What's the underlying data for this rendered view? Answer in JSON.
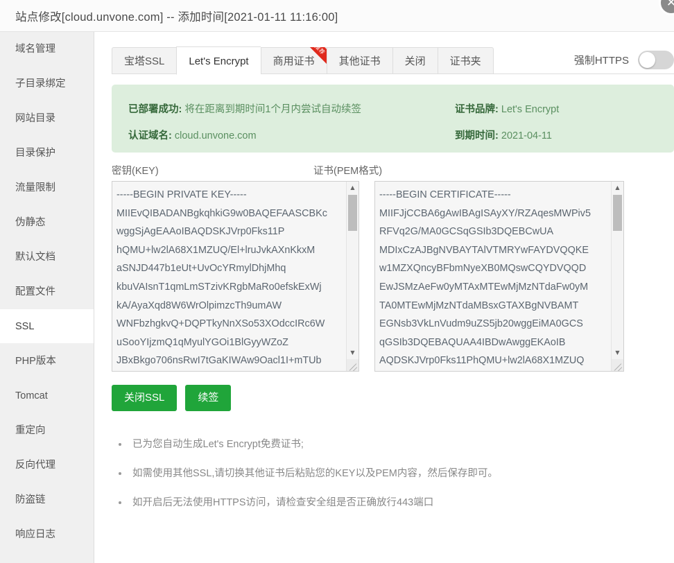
{
  "window": {
    "title": "站点修改[cloud.unvone.com] -- 添加时间[2021-01-11 11:16:00]",
    "close_icon": "close-icon",
    "close_glyph": "✕"
  },
  "sidebar": {
    "items": [
      {
        "label": "域名管理",
        "active": false
      },
      {
        "label": "子目录绑定",
        "active": false
      },
      {
        "label": "网站目录",
        "active": false
      },
      {
        "label": "目录保护",
        "active": false
      },
      {
        "label": "流量限制",
        "active": false
      },
      {
        "label": "伪静态",
        "active": false
      },
      {
        "label": "默认文档",
        "active": false
      },
      {
        "label": "配置文件",
        "active": false
      },
      {
        "label": "SSL",
        "active": true
      },
      {
        "label": "PHP版本",
        "active": false
      },
      {
        "label": "Tomcat",
        "active": false
      },
      {
        "label": "重定向",
        "active": false
      },
      {
        "label": "反向代理",
        "active": false
      },
      {
        "label": "防盗链",
        "active": false
      },
      {
        "label": "响应日志",
        "active": false
      }
    ]
  },
  "tabs": [
    {
      "label": "宝塔SSL",
      "active": false,
      "ribbon": ""
    },
    {
      "label": "Let's Encrypt",
      "active": true,
      "ribbon": ""
    },
    {
      "label": "商用证书",
      "active": false,
      "ribbon": "推荐"
    },
    {
      "label": "其他证书",
      "active": false,
      "ribbon": ""
    },
    {
      "label": "关闭",
      "active": false,
      "ribbon": ""
    },
    {
      "label": "证书夹",
      "active": false,
      "ribbon": ""
    }
  ],
  "https_toggle": {
    "label": "强制HTTPS",
    "state": "off"
  },
  "alert": {
    "deploy_key": "已部署成功:",
    "deploy_value": "将在距离到期时间1个月内尝试自动续签",
    "domain_key": "认证域名:",
    "domain_value": "cloud.unvone.com",
    "brand_key": "证书品牌:",
    "brand_value": "Let's Encrypt",
    "expire_key": "到期时间:",
    "expire_value": "2021-04-11",
    "bg_color": "#ddeedd"
  },
  "key_field": {
    "label": "密钥(KEY)",
    "value": "-----BEGIN PRIVATE KEY-----\nMIIEvQIBADANBgkqhkiG9w0BAQEFAASCBKc\nwggSjAgEAAoIBAQDSKJVrp0Fks11P\nhQMU+lw2lA68X1MZUQ/El+lruJvkAXnKkxM\naSNJD447b1eUt+UvOcYRmylDhjMhq\nkbuVAIsnT1qmLmSTzivKRgbMaRo0efskExWj\nkA/AyaXqd8W6WrOlpimzcTh9umAW\nWNFbzhgkvQ+DQPTkyNnXSo53XOdccIRc6W\nuSooYIjzmQ1qMyulYGOi1BlGyyWZoZ\nJBxBkgo706nsRwI7tGaKIWAw9Oacl1I+mTUb"
  },
  "pem_field": {
    "label": "证书(PEM格式)",
    "value": "-----BEGIN CERTIFICATE-----\nMIIFJjCCBA6gAwIBAgISAyXY/RZAqesMWPiv5\nRFVq2G/MA0GCSqGSIb3DQEBCwUA\nMDIxCzAJBgNVBAYTAlVTMRYwFAYDVQQKE\nw1MZXQncyBFbmNyeXB0MQswCQYDVQQD\nEwJSMzAeFw0yMTAxMTEwMjMzNTdaFw0yM\nTA0MTEwMjMzNTdaMBsxGTAXBgNVBAMT\nEGNsb3VkLnVudm9uZS5jb20wggEiMA0GCS\nqGSIb3DQEBAQUAA4IBDwAwggEKAoIB\nAQDSKJVrp0Fks11PhQMU+lw2lA68X1MZUQ"
  },
  "buttons": {
    "close_ssl": "关闭SSL",
    "renew": "续签",
    "color": "#20a53a"
  },
  "notes": [
    "已为您自动生成Let's Encrypt免费证书;",
    "如需使用其他SSL,请切换其他证书后粘贴您的KEY以及PEM内容，然后保存即可。",
    "如开启后无法使用HTTPS访问，请检查安全组是否正确放行443端口"
  ]
}
